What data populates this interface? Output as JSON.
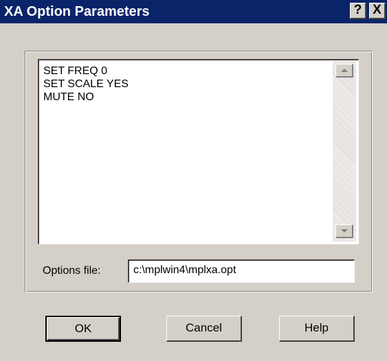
{
  "window": {
    "title": "XA Option Parameters",
    "help_button": "?",
    "close_button": "X"
  },
  "parameters": {
    "lines": [
      "SET FREQ 0",
      "SET SCALE YES",
      "MUTE NO"
    ]
  },
  "options_file": {
    "label": "Options file:",
    "value": "c:\\mplwin4\\mplxa.opt"
  },
  "buttons": {
    "ok": "OK",
    "cancel": "Cancel",
    "help": "Help"
  },
  "icons": {
    "scroll_up": "scroll-up-arrow-icon",
    "scroll_down": "scroll-down-arrow-icon"
  }
}
